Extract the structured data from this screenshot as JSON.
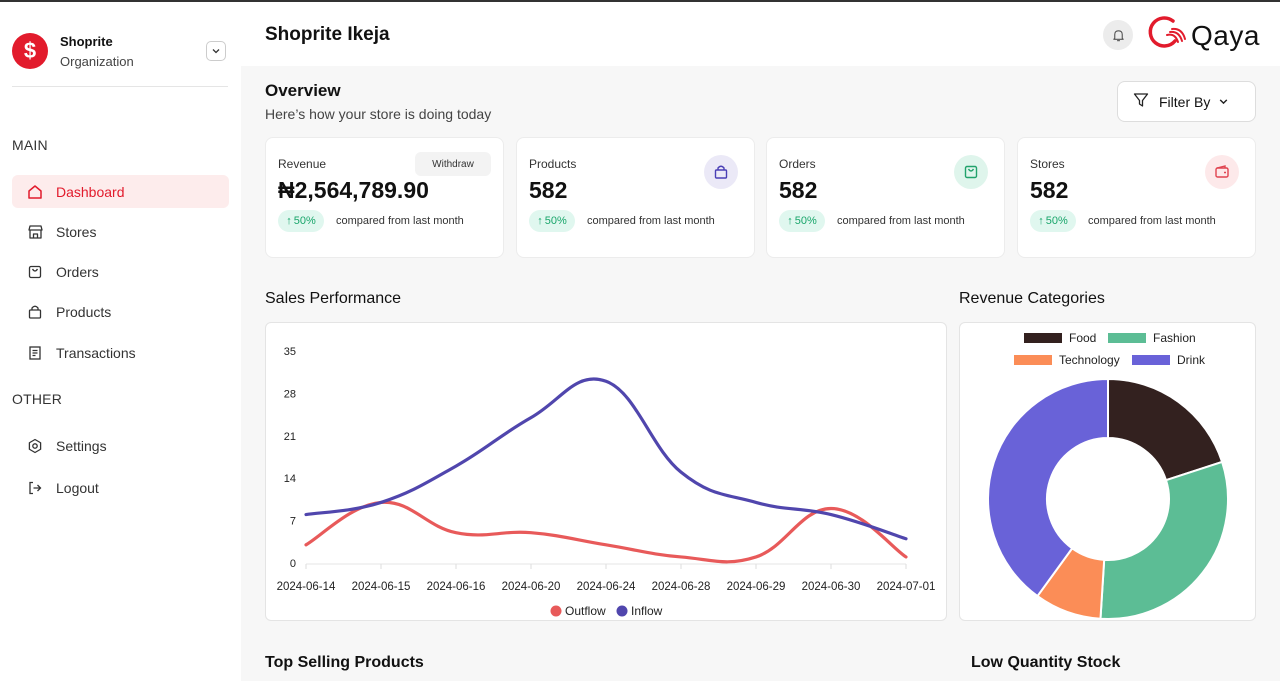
{
  "org": {
    "name": "Shoprite",
    "subtitle": "Organization",
    "logo_glyph": "$"
  },
  "sidebar": {
    "main_label": "MAIN",
    "other_label": "OTHER",
    "items": [
      {
        "label": "Dashboard",
        "icon": "home-icon",
        "active": true
      },
      {
        "label": "Stores",
        "icon": "store-icon"
      },
      {
        "label": "Orders",
        "icon": "bag-icon"
      },
      {
        "label": "Products",
        "icon": "lock-bag-icon"
      },
      {
        "label": "Transactions",
        "icon": "receipt-icon"
      }
    ],
    "other_items": [
      {
        "label": "Settings",
        "icon": "settings-icon"
      },
      {
        "label": "Logout",
        "icon": "logout-icon"
      }
    ]
  },
  "header": {
    "title": "Shoprite Ikeja",
    "brand": "Qaya"
  },
  "overview": {
    "title": "Overview",
    "subtitle": "Here’s how your store is doing today",
    "filter_label": "Filter By"
  },
  "cards": [
    {
      "label": "Revenue",
      "value": "₦2,564,789.90",
      "badge": "50%",
      "compare": "compared from last month",
      "action": "Withdraw"
    },
    {
      "label": "Products",
      "value": "582",
      "badge": "50%",
      "compare": "compared from last month",
      "icon": "bag-icon",
      "icon_bg": "#ebe9f7",
      "icon_color": "#4a3fb5"
    },
    {
      "label": "Orders",
      "value": "582",
      "badge": "50%",
      "compare": "compared from last month",
      "icon": "bag-check-icon",
      "icon_bg": "#dff5ec",
      "icon_color": "#21a26b"
    },
    {
      "label": "Stores",
      "value": "582",
      "badge": "50%",
      "compare": "compared from last month",
      "icon": "wallet-icon",
      "icon_bg": "#fde9ea",
      "icon_color": "#e0434f"
    }
  ],
  "sales": {
    "title": "Sales Performance"
  },
  "revenue_categories": {
    "title": "Revenue Categories"
  },
  "bottom": {
    "left_title": "Top Selling Products",
    "right_title": "Low Quantity Stock"
  },
  "colors": {
    "accent": "#e21b2c",
    "outflow": "#e85a5a",
    "inflow": "#5046ad",
    "food": "#33211f",
    "fashion": "#5cbd95",
    "technology": "#fb8d57",
    "drink": "#6962d8"
  },
  "chart_data": [
    {
      "type": "line",
      "categories": [
        "2024-06-14",
        "2024-06-15",
        "2024-06-16",
        "2024-06-20",
        "2024-06-24",
        "2024-06-28",
        "2024-06-29",
        "2024-06-30",
        "2024-07-01"
      ],
      "series": [
        {
          "name": "Outflow",
          "values": [
            3,
            10,
            5,
            5,
            3,
            1,
            1,
            9,
            1
          ]
        },
        {
          "name": "Inflow",
          "values": [
            8,
            10,
            16,
            24,
            30,
            15,
            10,
            8,
            4
          ]
        }
      ],
      "yticks": [
        0,
        7,
        14,
        21,
        28,
        35
      ],
      "ylim": [
        0,
        35
      ],
      "legend": "bottom",
      "grid": false
    },
    {
      "type": "pie",
      "labels": [
        "Food",
        "Fashion",
        "Technology",
        "Drink"
      ],
      "values": [
        20,
        31,
        9,
        40
      ],
      "legend": "top"
    }
  ]
}
